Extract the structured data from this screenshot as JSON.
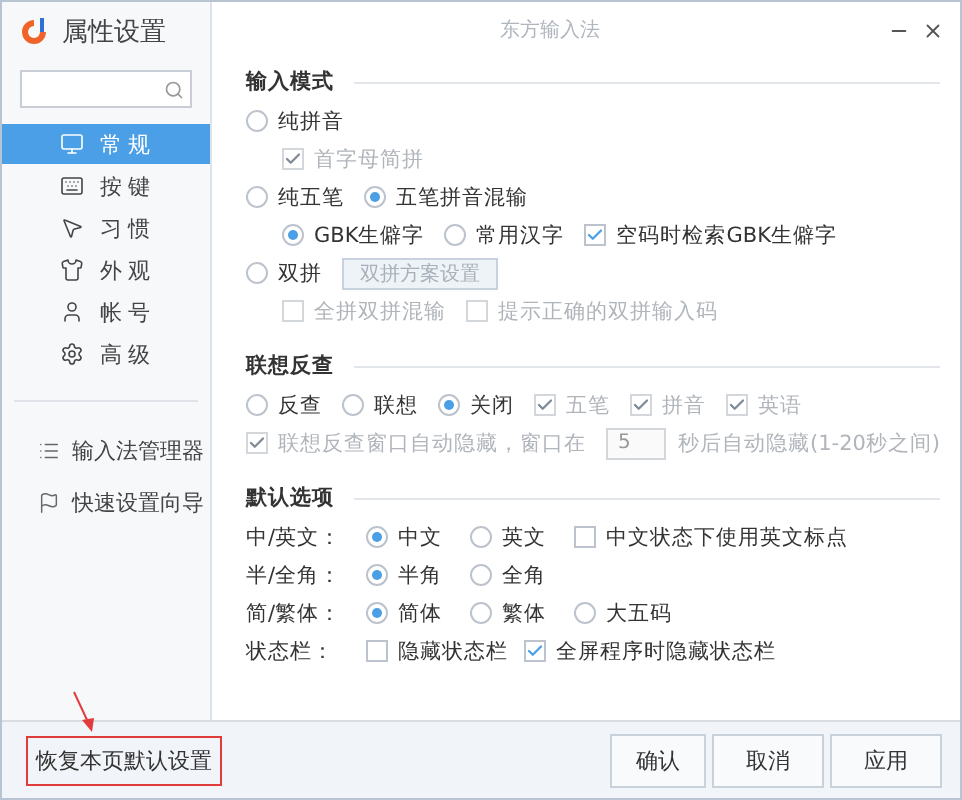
{
  "window": {
    "title": "属性设置",
    "app_title": "东方输入法"
  },
  "sidebar": {
    "items": [
      {
        "label": "常规",
        "selected": true
      },
      {
        "label": "按键",
        "selected": false
      },
      {
        "label": "习惯",
        "selected": false
      },
      {
        "label": "外观",
        "selected": false
      },
      {
        "label": "帐号",
        "selected": false
      },
      {
        "label": "高级",
        "selected": false
      }
    ],
    "tools": [
      {
        "label": "输入法管理器"
      },
      {
        "label": "快速设置向导"
      }
    ]
  },
  "sections": [
    {
      "title": "输入模式",
      "rows": [
        {
          "controls": [
            {
              "kind": "radio",
              "label": "纯拼音",
              "selected": false
            }
          ],
          "children": [
            {
              "controls": [
                {
                  "kind": "checkbox",
                  "label": "首字母简拼",
                  "checked": true,
                  "disabled": true
                }
              ]
            }
          ]
        },
        {
          "controls": [
            {
              "kind": "radio",
              "label": "纯五笔",
              "selected": false
            },
            {
              "kind": "radio",
              "label": "五笔拼音混输",
              "selected": true
            }
          ],
          "children": [
            {
              "controls": [
                {
                  "kind": "radio",
                  "label": "GBK生僻字",
                  "selected": true
                },
                {
                  "kind": "radio",
                  "label": "常用汉字",
                  "selected": false
                },
                {
                  "kind": "checkbox",
                  "label": "空码时检索GBK生僻字",
                  "checked": true,
                  "disabled": false
                }
              ]
            }
          ]
        },
        {
          "controls": [
            {
              "kind": "radio",
              "label": "双拼",
              "selected": false
            },
            {
              "kind": "button",
              "label": "双拼方案设置",
              "disabled": true
            }
          ],
          "children": [
            {
              "controls": [
                {
                  "kind": "checkbox",
                  "label": "全拼双拼混输",
                  "checked": false,
                  "disabled": true
                },
                {
                  "kind": "checkbox",
                  "label": "提示正确的双拼输入码",
                  "checked": false,
                  "disabled": true
                }
              ]
            }
          ]
        }
      ]
    },
    {
      "title": "联想反查",
      "rows": [
        {
          "controls": [
            {
              "kind": "radio",
              "label": "反查",
              "selected": false
            },
            {
              "kind": "radio",
              "label": "联想",
              "selected": false
            },
            {
              "kind": "radio",
              "label": "关闭",
              "selected": true
            },
            {
              "kind": "checkbox",
              "label": "五笔",
              "checked": true,
              "disabled": true
            },
            {
              "kind": "checkbox",
              "label": "拼音",
              "checked": true,
              "disabled": true
            },
            {
              "kind": "checkbox",
              "label": "英语",
              "checked": true,
              "disabled": true
            }
          ]
        },
        {
          "controls": [
            {
              "kind": "checkbox",
              "label": "联想反查窗口自动隐藏，窗口在",
              "checked": true,
              "disabled": true
            },
            {
              "kind": "field",
              "value": "5",
              "disabled": true
            },
            {
              "kind": "text",
              "label": "秒后自动隐藏(1-20秒之间)",
              "disabled": true
            }
          ]
        }
      ]
    },
    {
      "title": "默认选项",
      "rows": [
        {
          "label": "中/英文：",
          "controls": [
            {
              "kind": "radio",
              "label": "中文",
              "selected": true
            },
            {
              "kind": "radio",
              "label": "英文",
              "selected": false
            },
            {
              "kind": "checkbox",
              "label": "中文状态下使用英文标点",
              "checked": false,
              "disabled": false
            }
          ]
        },
        {
          "label": "半/全角：",
          "controls": [
            {
              "kind": "radio",
              "label": "半角",
              "selected": true
            },
            {
              "kind": "radio",
              "label": "全角",
              "selected": false
            }
          ]
        },
        {
          "label": "简/繁体：",
          "controls": [
            {
              "kind": "radio",
              "label": "简体",
              "selected": true
            },
            {
              "kind": "radio",
              "label": "繁体",
              "selected": false
            },
            {
              "kind": "radio",
              "label": "大五码",
              "selected": false
            }
          ]
        },
        {
          "label": "状态栏：",
          "controls": [
            {
              "kind": "checkbox",
              "label": "隐藏状态栏",
              "checked": false,
              "disabled": false
            },
            {
              "kind": "checkbox",
              "label": "全屏程序时隐藏状态栏",
              "checked": true,
              "disabled": false
            }
          ]
        }
      ]
    }
  ],
  "footer": {
    "restore": "恢复本页默认设置",
    "buttons": [
      "确认",
      "取消",
      "应用"
    ]
  }
}
